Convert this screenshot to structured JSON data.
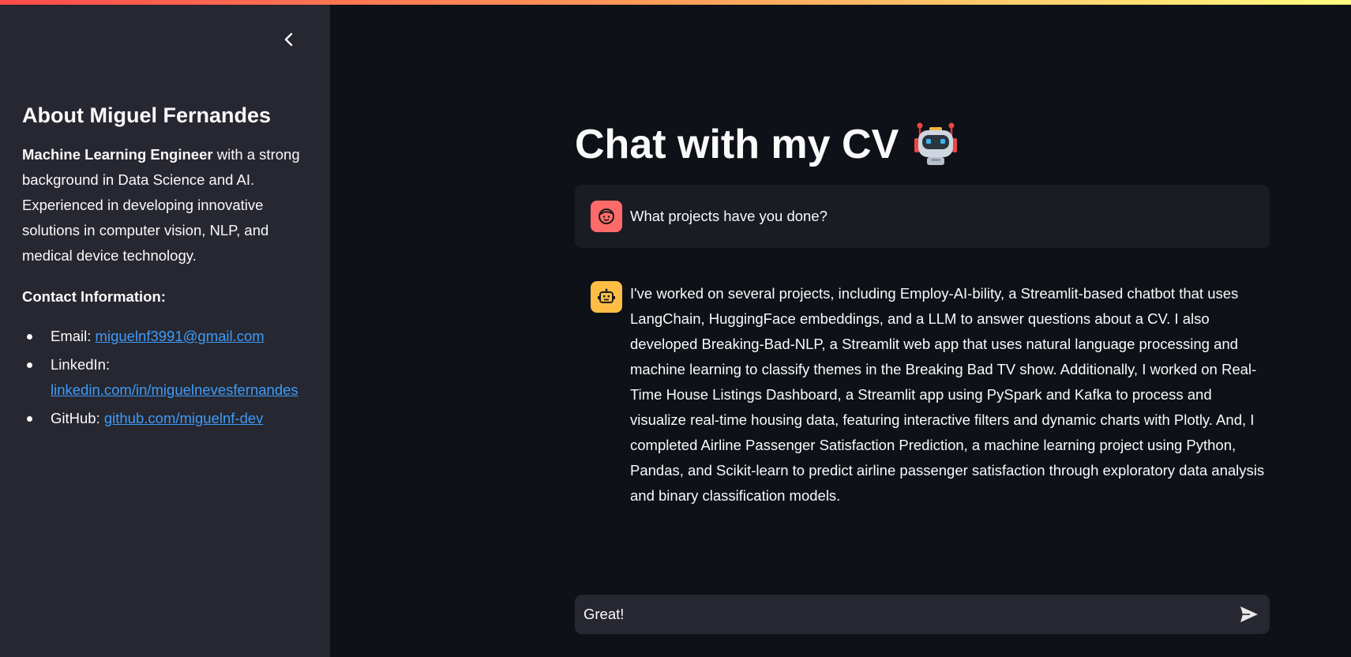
{
  "sidebar": {
    "heading": "About Miguel Fernandes",
    "bio_bold": "Machine Learning Engineer",
    "bio_rest": " with a strong background in Data Science and AI. Experienced in developing innovative solutions in computer vision, NLP, and medical device technology.",
    "contact_title": "Contact Information:",
    "contacts": [
      {
        "label": "Email: ",
        "link": "miguelnf3991@gmail.com"
      },
      {
        "label": "LinkedIn: ",
        "link": "linkedin.com/in/miguelnevesfernandes"
      },
      {
        "label": "GitHub: ",
        "link": "github.com/miguelnf-dev"
      }
    ],
    "collapse_icon": "chevron-left-icon"
  },
  "main": {
    "title": "Chat with my CV",
    "title_emoji": "robot-emoji",
    "messages": [
      {
        "role": "user",
        "avatar": "user-face-icon",
        "text": "What projects have you done?"
      },
      {
        "role": "assistant",
        "avatar": "bot-icon",
        "text": "I've worked on several projects, including Employ-AI-bility, a Streamlit-based chatbot that uses LangChain, HuggingFace embeddings, and a LLM to answer questions about a CV. I also developed Breaking-Bad-NLP, a Streamlit web app that uses natural language processing and machine learning to classify themes in the Breaking Bad TV show. Additionally, I worked on Real-Time House Listings Dashboard, a Streamlit app using PySpark and Kafka to process and visualize real-time housing data, featuring interactive filters and dynamic charts with Plotly. And, I completed Airline Passenger Satisfaction Prediction, a machine learning project using Python, Pandas, and Scikit-learn to predict airline passenger satisfaction through exploratory data analysis and binary classification models."
      }
    ],
    "input": {
      "value": "Great!",
      "send_icon": "send-icon"
    }
  },
  "colors": {
    "background": "#0e1117",
    "sidebar": "#262730",
    "link": "#3e9bf8",
    "user_avatar": "#ff6b6b",
    "bot_avatar": "#ffbd45"
  }
}
